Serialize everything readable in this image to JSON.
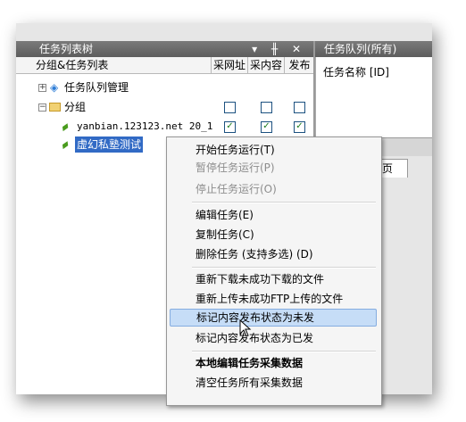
{
  "left_panel": {
    "title": "任务列表树",
    "controls": "▾ ╫ ✕",
    "columns": {
      "name": "分组&任务列表",
      "col1": "采网址",
      "col2": "采内容",
      "col3": "发布"
    }
  },
  "tree": {
    "queue_mgmt": "任务队列管理",
    "group": "分组",
    "task1": "yanbian.123123.net 20_1",
    "task2": "虚幻私塾测试",
    "task1_checks": [
      true,
      true,
      true
    ],
    "group_checks": [
      false,
      false,
      false
    ]
  },
  "right_panel": {
    "title": "任务队列(所有)",
    "column_header": "任务名称 [ID]",
    "tab_label": "页"
  },
  "context_menu": {
    "items": [
      {
        "label": "开始任务运行(T)",
        "state": "enabled"
      },
      {
        "label": "暂停任务运行(P)",
        "state": "disabled"
      },
      {
        "label": "停止任务运行(O)",
        "state": "disabled"
      },
      {
        "label": "编辑任务(E)",
        "state": "enabled"
      },
      {
        "label": "复制任务(C)",
        "state": "enabled"
      },
      {
        "label": "删除任务 (支持多选) (D)",
        "state": "enabled"
      },
      {
        "label": "重新下载未成功下载的文件",
        "state": "enabled"
      },
      {
        "label": "重新上传未成功FTP上传的文件",
        "state": "enabled"
      },
      {
        "label": "标记内容发布状态为未发",
        "state": "hover"
      },
      {
        "label": "标记内容发布状态为已发",
        "state": "enabled"
      },
      {
        "label": "本地编辑任务采集数据",
        "state": "bold"
      },
      {
        "label": "清空任务所有采集数据",
        "state": "enabled"
      }
    ]
  },
  "colors": {
    "selection": "#316ac5",
    "hover": "#c6ddf7",
    "title_bar": "#6a6a6a"
  }
}
